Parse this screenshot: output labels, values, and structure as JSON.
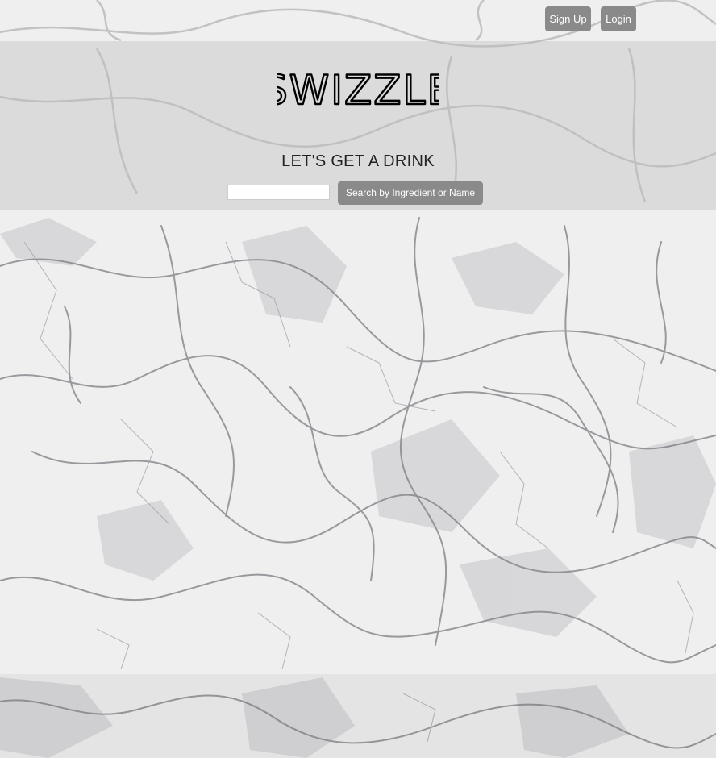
{
  "nav": {
    "signup_label": "Sign Up",
    "login_label": "Login"
  },
  "hero": {
    "logo_text": "SWIZZLE",
    "tagline": "LET'S GET A DRINK"
  },
  "search": {
    "value": "",
    "placeholder": "",
    "button_label": "Search by Ingredient or Name"
  },
  "colors": {
    "button_bg": "#8a8a8a",
    "button_text": "#ffffff",
    "logo": "#000000",
    "tagline": "#222222",
    "background": "#eeeeef"
  },
  "icons": {
    "background": "marble-texture"
  }
}
